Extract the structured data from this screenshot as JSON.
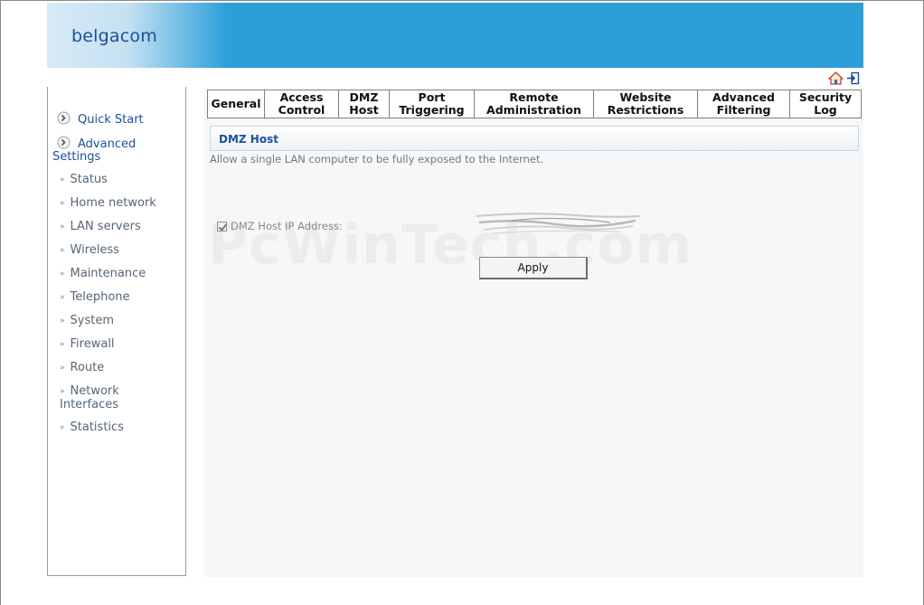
{
  "header": {
    "logo_text": "belgacom",
    "brand_color": "#2c9ed8",
    "icons": [
      "home-icon",
      "logout-icon"
    ]
  },
  "sidebar": {
    "quick_start": "Quick Start",
    "advanced_settings_line1": "Advanced",
    "advanced_settings_line2": "Settings",
    "items": [
      {
        "label": "Status"
      },
      {
        "label": "Home network"
      },
      {
        "label": "LAN servers"
      },
      {
        "label": "Wireless"
      },
      {
        "label": "Maintenance"
      },
      {
        "label": "Telephone"
      },
      {
        "label": "System"
      },
      {
        "label": "Firewall"
      },
      {
        "label": "Route"
      },
      {
        "label": "Network",
        "label2": "Interfaces"
      },
      {
        "label": "Statistics"
      }
    ]
  },
  "tabs": [
    {
      "line1": "General",
      "line2": ""
    },
    {
      "line1": "Access",
      "line2": "Control"
    },
    {
      "line1": "DMZ",
      "line2": "Host"
    },
    {
      "line1": "Port",
      "line2": "Triggering"
    },
    {
      "line1": "Remote",
      "line2": "Administration"
    },
    {
      "line1": "Website",
      "line2": "Restrictions"
    },
    {
      "line1": "Advanced",
      "line2": "Filtering"
    },
    {
      "line1": "Security",
      "line2": "Log"
    }
  ],
  "main": {
    "section_title": "DMZ Host",
    "description": "Allow a single LAN computer to be fully exposed to the Internet.",
    "dmz_checkbox_label": "DMZ Host IP Address:",
    "dmz_checked": true,
    "apply_label": "Apply"
  },
  "watermark": "PcWinTech.com"
}
